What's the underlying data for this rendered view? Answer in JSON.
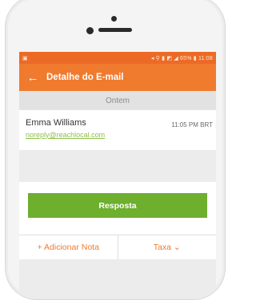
{
  "status_bar": {
    "left_icon": "android-icon",
    "right_text": "◂ ⚲ ▮ ◩ ◢ 65% ▮ 11:08"
  },
  "app_bar": {
    "back_icon": "arrow-left-icon",
    "title": "Detalhe do E-mail"
  },
  "date_header": "Ontem",
  "message": {
    "sender": "Emma Williams",
    "email": "noreply@reachlocal.com",
    "time": "11:05 PM BRT"
  },
  "actions": {
    "reply_label": "Resposta",
    "add_note_label": "+ Adicionar Nota",
    "tag_label": "Taxa ⌄"
  },
  "colors": {
    "header_orange": "#f07a2e",
    "status_orange": "#ec6a25",
    "reply_green": "#6eaf2e",
    "link_green": "#8fbf4a"
  }
}
